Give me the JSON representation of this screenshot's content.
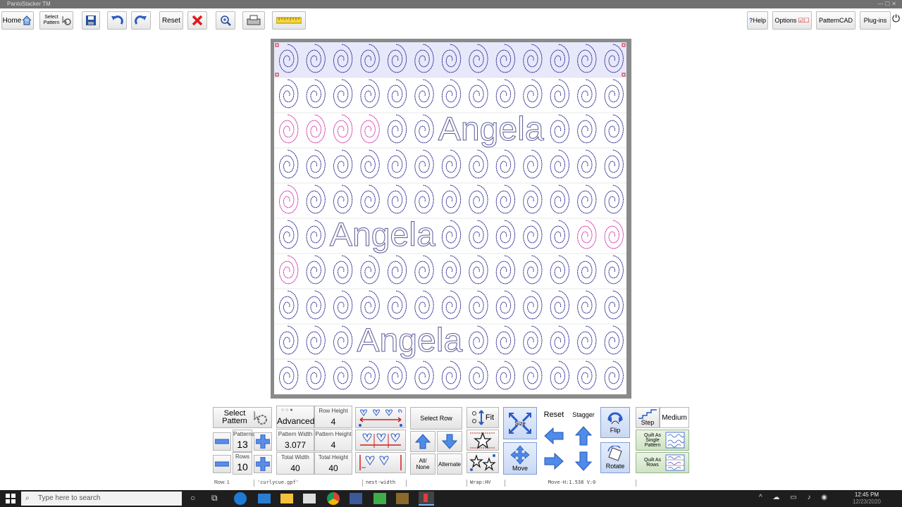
{
  "window": {
    "title": "PantoStacker TM"
  },
  "toolbar": {
    "home_label": "Home",
    "select_pattern_label": "Select Pattern",
    "reset_label": "Reset",
    "help_label": "Help",
    "options_label": "Options",
    "patterncad_label": "PatternCAD",
    "plugins_label": "Plug-ins"
  },
  "canvas": {
    "rows": 10,
    "columns": 13,
    "text_labels": [
      "Angela",
      "Angela",
      "Angela"
    ],
    "colors": {
      "pattern": "#1a1a8a",
      "highlight": "#d01ca0",
      "selected_row_bg": "#e8e8fb"
    }
  },
  "panel": {
    "select_pattern_label": "Select Pattern",
    "patterns_label": "Patterns",
    "patterns_value": "13",
    "rows_label": "Rows",
    "rows_value": "10",
    "advanced_label": "Advanced",
    "row_height_label": "Row Height",
    "row_height_value": "4",
    "pattern_width_label": "Pattern Width",
    "pattern_width_value": "3.077",
    "pattern_height_label": "Pattern Height",
    "pattern_height_value": "4",
    "total_width_label": "Total Width",
    "total_width_value": "40",
    "total_height_label": "Total Height",
    "total_height_value": "40",
    "select_row_label": "Select Row",
    "all_none_label": "All/ None",
    "alternate_label": "Alternate",
    "fit_label": "Fit",
    "size_label": "Size",
    "move_label": "Move",
    "reset_label": "Reset",
    "stagger_label": "Stagger",
    "flip_label": "Flip",
    "rotate_label": "Rotate",
    "step_label": "Step",
    "step_value": "Medium",
    "quilt_single_label": "Quilt As Single Pattern",
    "quilt_rows_label": "Quilt As Rows"
  },
  "status": {
    "row": "Row: 1",
    "file": "'curlycue.gpf'",
    "mode": "nest-width",
    "wrap": "Wrap:HV",
    "move": "Move-H:1.538 V:0"
  },
  "taskbar": {
    "search_placeholder": "Type here to search",
    "time": "12:45 PM",
    "date": "12/23/2020"
  }
}
